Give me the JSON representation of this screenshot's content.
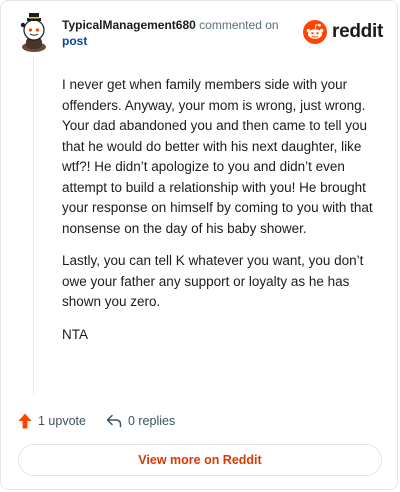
{
  "comment": {
    "username": "TypicalManagement680",
    "action_text": "commented on",
    "post_link": "post",
    "paragraphs": [
      "I never get when family members side with your offenders. Anyway, your mom is wrong, just wrong. Your dad abandoned you and then came to tell you that he would do better with his next daughter, like wtf?! He didn’t apologize to you and didn’t even attempt to build a relationship with you! He brought your response on himself by coming to you with that nonsense on the day of his baby shower.",
      "Lastly, you can tell K whatever you want, you don’t owe your father any support or loyalty as he has shown you zero.",
      "NTA"
    ]
  },
  "brand": {
    "name": "reddit",
    "color": "#ff4500"
  },
  "actions": {
    "upvote_label": "1 upvote",
    "upvote_icon": "upvote-arrow-icon",
    "upvote_color": "#ff4500",
    "replies_label": "0 replies",
    "replies_icon": "reply-arrow-icon"
  },
  "footer": {
    "view_more_label": "View more on Reddit",
    "view_more_color": "#d93a00"
  }
}
